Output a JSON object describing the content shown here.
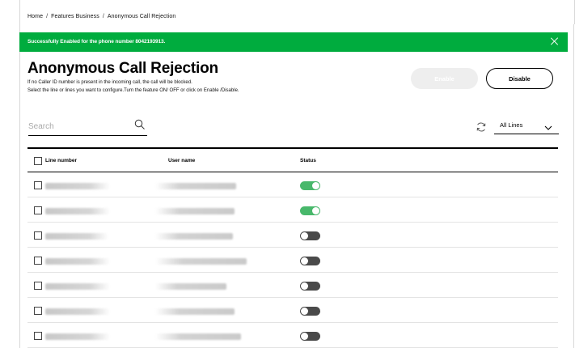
{
  "breadcrumb": {
    "items": [
      "Home",
      "Features Business",
      "Anonymous Call Rejection"
    ],
    "separator": "/"
  },
  "banner": {
    "message": "Successfully Enabled for the phone number 8042193913.",
    "close_icon": "close-icon",
    "color": "#00ac3e"
  },
  "page": {
    "title": "Anonymous Call Rejection",
    "description_1": "If no Caller ID number is present in the incoming call, the call will be blocked.",
    "description_2": "Select the line or lines you want to configure.Turn the feature ON/ OFF or click on Enable /Disable."
  },
  "actions": {
    "enable_label": "Enable",
    "disable_label": "Disable"
  },
  "search": {
    "placeholder": "Search",
    "value": "",
    "icon": "search-icon"
  },
  "filter": {
    "refresh_icon": "refresh-icon",
    "selected": "All Lines",
    "chevron_icon": "chevron-down-icon"
  },
  "table": {
    "headers": {
      "line_number": "Line number",
      "user_name": "User name",
      "status": "Status"
    },
    "rows": [
      {
        "status": "on"
      },
      {
        "status": "on"
      },
      {
        "status": "off"
      },
      {
        "status": "off"
      },
      {
        "status": "off"
      },
      {
        "status": "off"
      },
      {
        "status": "off"
      }
    ]
  },
  "colors": {
    "toggle_on": "#48b86b",
    "toggle_off": "#4a4a4a",
    "enable_disabled_bg": "#eeeeee"
  }
}
